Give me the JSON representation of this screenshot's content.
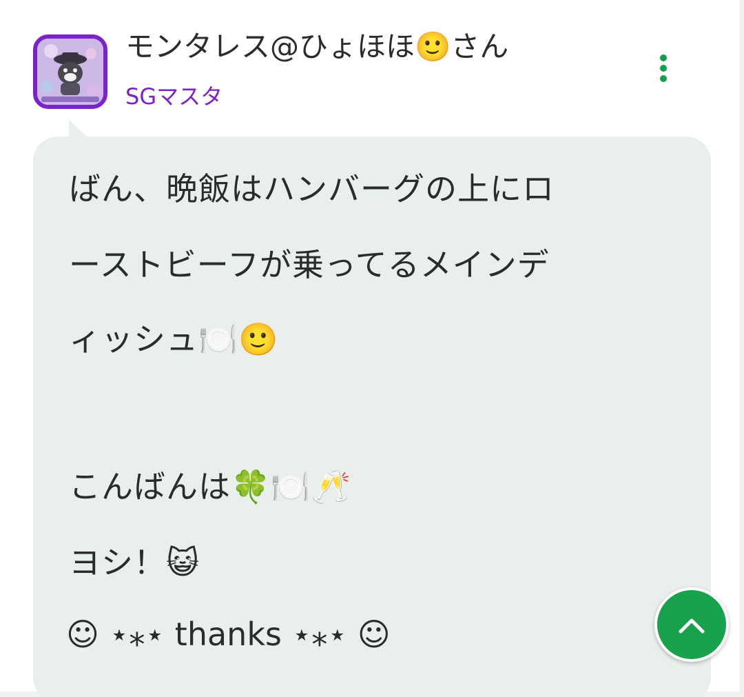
{
  "post": {
    "user_name": "モンタレス@ひょほほ🙂さん",
    "user_title": "SGマスタ",
    "lines": [
      "ばん、晩飯はハンバーグの上にロ",
      "ーストビーフが乗ってるメインデ",
      "ィッシュ🍽️🙂",
      "こんばんは🍀🍽️🥂",
      "ヨシ！😺",
      "☺︎ ⋆⁎⋆ thanks ⋆⁎⋆ ☺︎"
    ]
  },
  "icons": {
    "menu": "more-vertical-icon",
    "scroll_top": "chevron-up-icon",
    "avatar": "user-avatar-image"
  },
  "colors": {
    "accent": "#14a04a",
    "title": "#7b22c9",
    "bubble": "#e9efea"
  }
}
